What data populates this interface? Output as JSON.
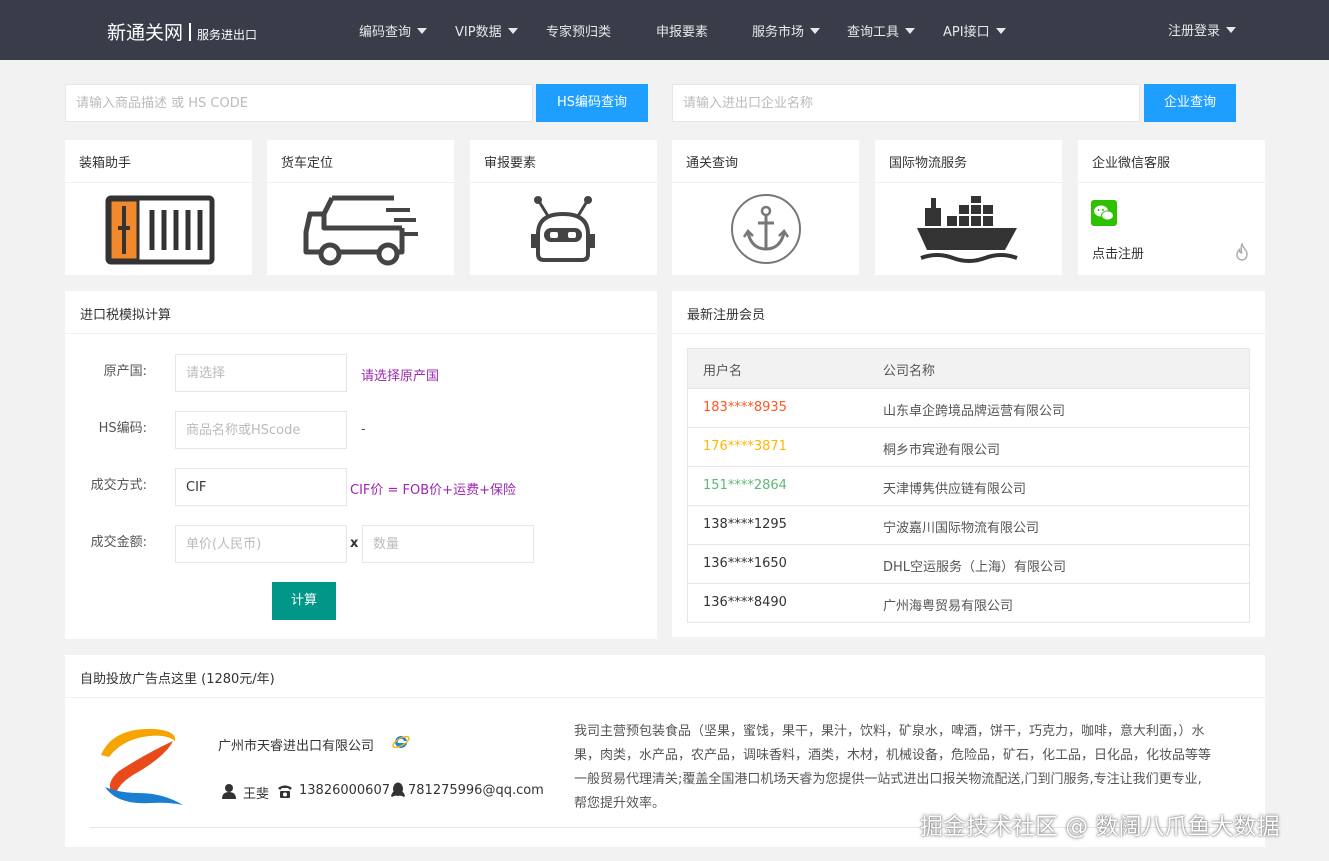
{
  "header": {
    "logo_main": "新通关网",
    "logo_sub": "服务进出口",
    "nav": [
      {
        "label": "编码查询",
        "dropdown": true
      },
      {
        "label": "VIP数据",
        "dropdown": true
      },
      {
        "label": "专家预归类",
        "dropdown": false
      },
      {
        "label": "申报要素",
        "dropdown": false
      },
      {
        "label": "服务市场",
        "dropdown": true
      },
      {
        "label": "查询工具",
        "dropdown": true
      },
      {
        "label": "API接口",
        "dropdown": true
      }
    ],
    "login": "注册登录"
  },
  "search": {
    "hs_placeholder": "请输入商品描述 或 HS CODE",
    "hs_button": "HS编码查询",
    "company_placeholder": "请输入进出口企业名称",
    "company_button": "企业查询"
  },
  "tiles": [
    {
      "title": "装箱助手",
      "icon": "container-icon"
    },
    {
      "title": "货车定位",
      "icon": "truck-icon"
    },
    {
      "title": "审报要素",
      "icon": "robot-icon"
    },
    {
      "title": "通关查询",
      "icon": "anchor-icon"
    },
    {
      "title": "国际物流服务",
      "icon": "cargo-ship-icon"
    },
    {
      "title": "企业微信客服",
      "icon": "wechat-icon",
      "link": "点击注册"
    }
  ],
  "tax": {
    "title": "进口税模拟计算",
    "origin_label": "原产国:",
    "origin_placeholder": "请选择",
    "origin_hint": "请选择原产国",
    "hs_label": "HS编码:",
    "hs_placeholder": "商品名称或HScode",
    "hs_hint": "-",
    "trade_label": "成交方式:",
    "trade_value": "CIF",
    "trade_hint": "CIF价 = FOB价+运费+保险",
    "amount_label": "成交金额:",
    "price_placeholder": "单价(人民币)",
    "times": "x",
    "qty_placeholder": "数量",
    "calc_button": "计算"
  },
  "members": {
    "title": "最新注册会员",
    "col_user": "用户名",
    "col_company": "公司名称",
    "rows": [
      {
        "user": "183****8935",
        "company": "山东卓企跨境品牌运营有限公司",
        "color": "#ff5722"
      },
      {
        "user": "176****3871",
        "company": "桐乡市宾逊有限公司",
        "color": "#ffb800"
      },
      {
        "user": "151****2864",
        "company": "天津博隽供应链有限公司",
        "color": "#5fb878"
      },
      {
        "user": "138****1295",
        "company": "宁波嘉川国际物流有限公司",
        "color": "#333333"
      },
      {
        "user": "136****1650",
        "company": "DHL空运服务（上海）有限公司",
        "color": "#333333"
      },
      {
        "user": "136****8490",
        "company": "广州海粤贸易有限公司",
        "color": "#333333"
      }
    ]
  },
  "ad": {
    "title": "自助投放广告点这里 (1280元/年)",
    "company": "广州市天睿进出口有限公司",
    "contact": "王斐",
    "phone": "13826000607",
    "qq": "781275996@qq.com",
    "description": "我司主营预包装食品（坚果，蜜饯，果干，果汁，饮料，矿泉水，啤酒，饼干，巧克力，咖啡，意大利面，）水果，肉类，水产品，农产品，调味香料，酒类，木材，机械设备，危险品，矿石，化工品，日化品，化妆品等等一般贸易代理清关;覆盖全国港口机场天睿为您提供一站式进出口报关物流配送,门到门服务,专注让我们更专业,帮您提升效率。"
  },
  "watermark": "掘金技术社区 @ 数阔八爪鱼大数据",
  "colors": {
    "header_bg": "#393d49",
    "primary": "#1e9fff",
    "calc": "#009688",
    "hint": "#9c27b0"
  }
}
